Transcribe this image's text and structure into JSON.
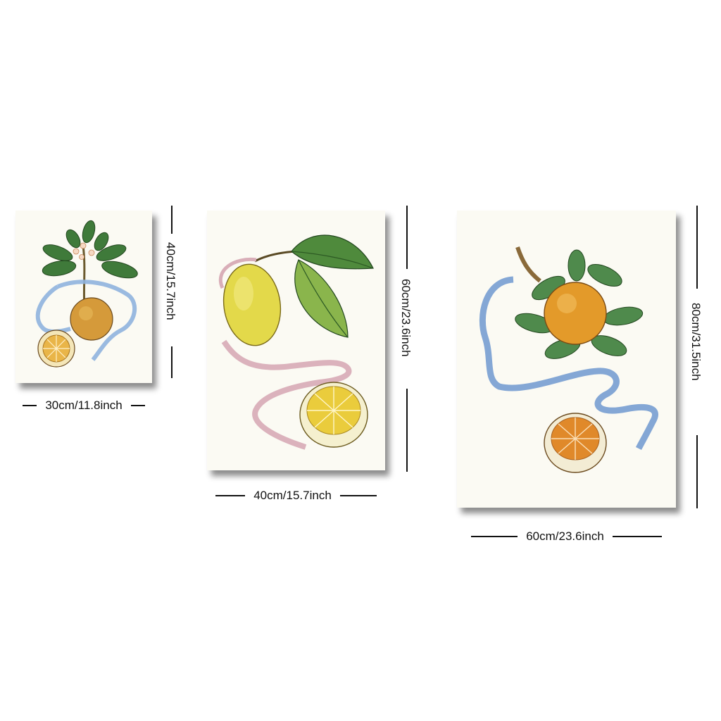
{
  "prints": [
    {
      "name": "small-print",
      "subject": "orange-branch-with-half-fruit",
      "width_label": "30cm/11.8inch",
      "height_label": "40cm/15.7inch"
    },
    {
      "name": "medium-print",
      "subject": "lemon-with-leaves-and-half-fruit",
      "width_label": "40cm/15.7inch",
      "height_label": "60cm/23.6inch"
    },
    {
      "name": "large-print",
      "subject": "bitter-orange-with-leaves-and-half-fruit",
      "width_label": "60cm/23.6inch",
      "height_label": "80cm/31.5inch"
    }
  ],
  "colors": {
    "background": "#ffffff",
    "paper": "#fbfaf3",
    "ribbon_blue": "#8fb3de",
    "ribbon_pink": "#d9aeb8",
    "leaf_green": "#3f7a3a",
    "lemon_yellow": "#e3d94a",
    "orange": "#e39a2a"
  }
}
